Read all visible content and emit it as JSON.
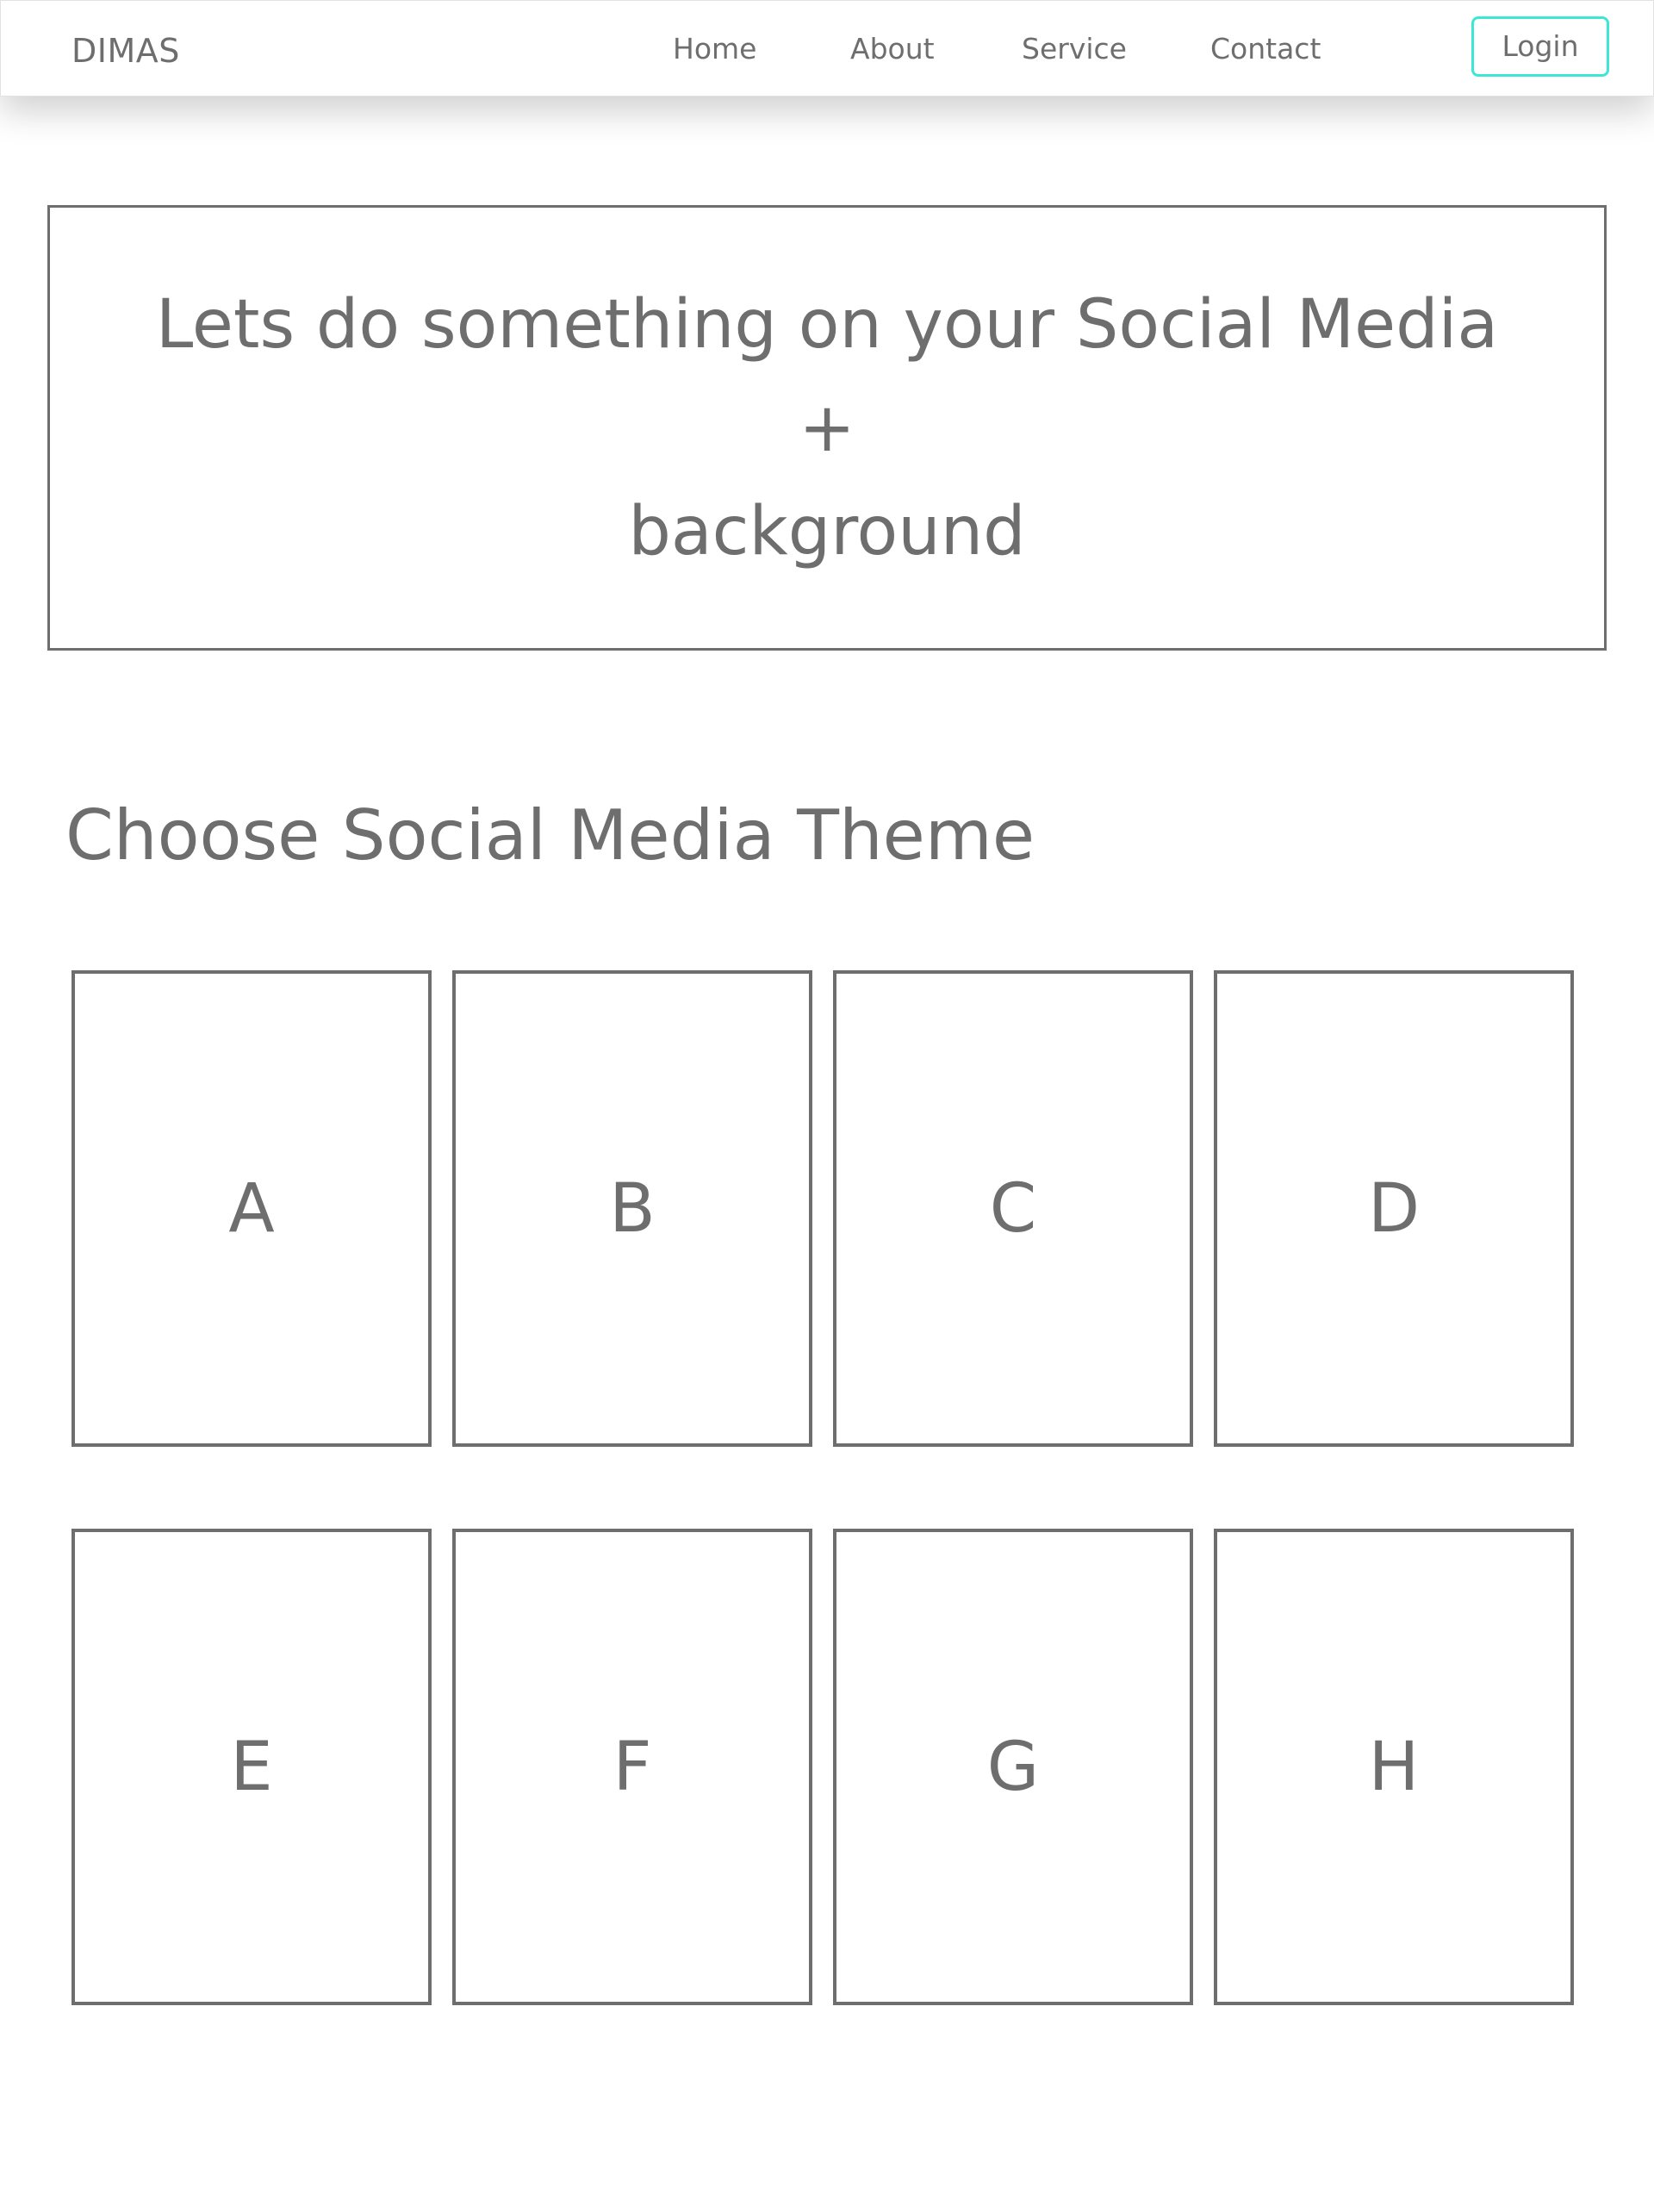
{
  "navbar": {
    "brand": "DIMAS",
    "links": [
      "Home",
      "About",
      "Service",
      "Contact"
    ],
    "login_label": "Login",
    "login_border_color": "#3ee6d6"
  },
  "hero": {
    "line1": "Lets do something on your Social Media",
    "line2": "+",
    "line3": "background"
  },
  "themes": {
    "title": "Choose Social Media Theme",
    "items": [
      "A",
      "B",
      "C",
      "D",
      "E",
      "F",
      "G",
      "H"
    ]
  },
  "colors": {
    "text": "#6e6e6e",
    "border": "#6e6e6e",
    "accent": "#3ee6d6",
    "background": "#ffffff"
  }
}
